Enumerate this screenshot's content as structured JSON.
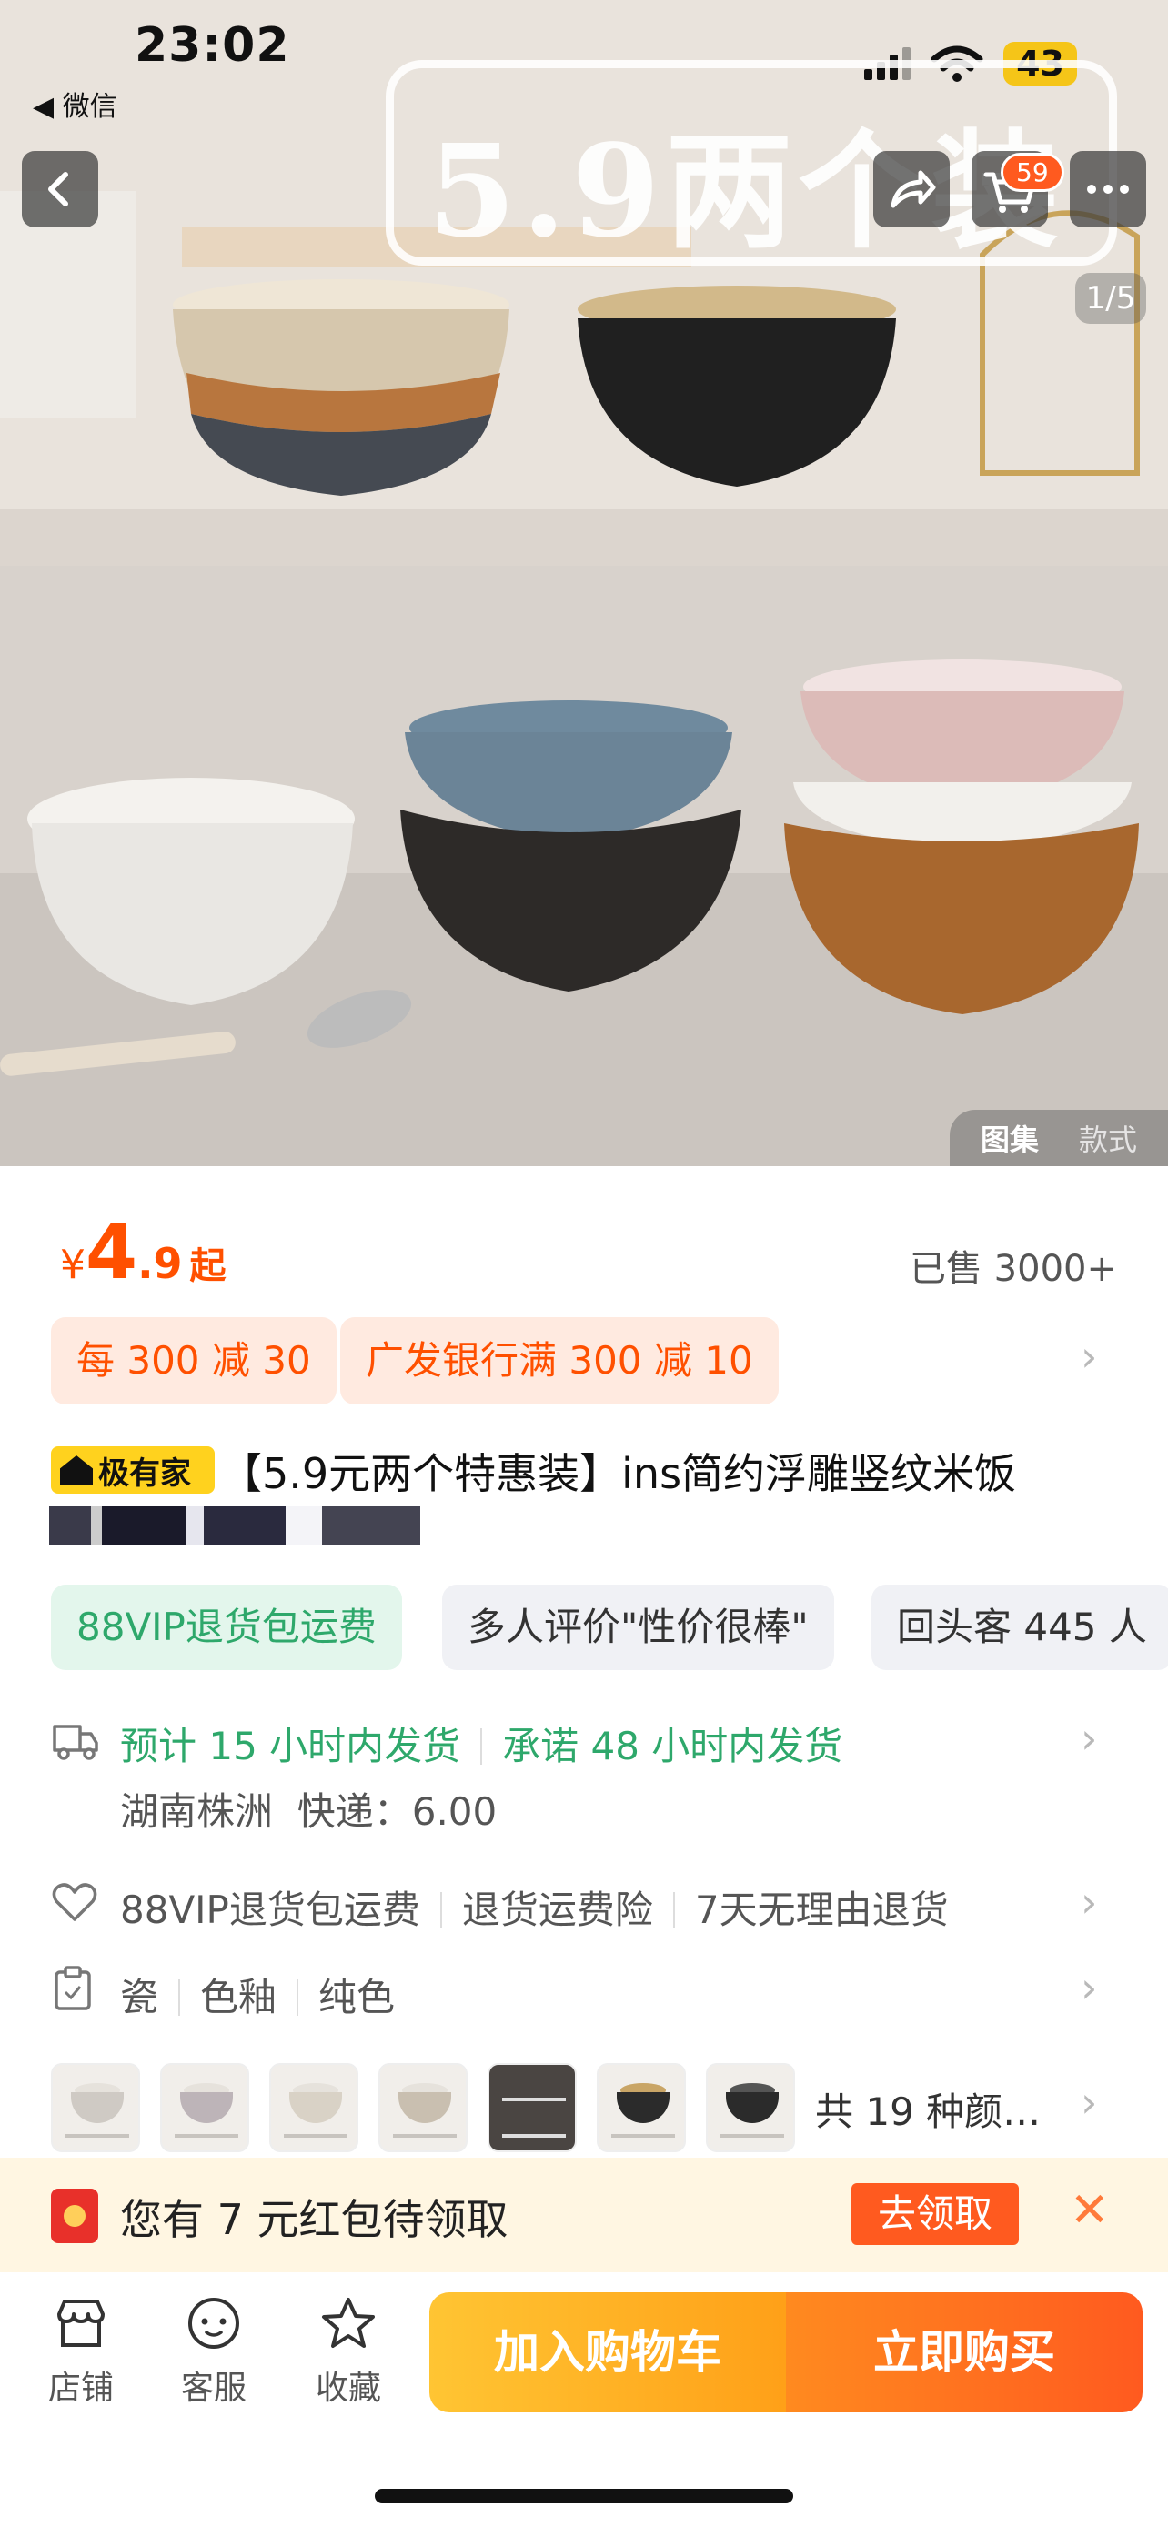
{
  "status_bar": {
    "time": "23:02",
    "back_app": "◀ 微信",
    "battery": "43"
  },
  "hero": {
    "promo_text": "5.9两个装",
    "cart_badge": "59",
    "counter": "1/5",
    "tabs": [
      "图集",
      "款式"
    ]
  },
  "price": {
    "currency": "¥",
    "integer": "4",
    "decimal": ".9",
    "suffix": "起",
    "sold": "已售 3000+"
  },
  "coupons": [
    "每 300 减 30",
    "广发银行满 300 减 10"
  ],
  "product": {
    "brand_badge": "极有家",
    "title": "【5.9元两个特惠装】ins简约浮雕竖纹米饭"
  },
  "tags": [
    "88VIP退货包运费",
    "多人评价\"性价很棒\"",
    "回头客 445 人"
  ],
  "shipping": {
    "estimate": "预计 15 小时内发货",
    "promise": "承诺 48 小时内发货",
    "origin": "湖南株洲",
    "fee": "快递：6.00"
  },
  "services": [
    "88VIP退货包运费",
    "退货运费险",
    "7天无理由退货"
  ],
  "attributes": [
    "瓷",
    "色釉",
    "纯色"
  ],
  "variants": {
    "label": "共 19 种颜…"
  },
  "banner": {
    "text": "您有 7 元红包待领取",
    "button": "去领取"
  },
  "bottom_bar": {
    "shop": "店铺",
    "service": "客服",
    "favorite": "收藏",
    "add_to_cart": "加入购物车",
    "buy_now": "立即购买"
  },
  "colors": {
    "accent": "#ff5000",
    "green": "#2ea86b",
    "cart_start": "#ffc533",
    "buy_end": "#ff5a1f"
  }
}
